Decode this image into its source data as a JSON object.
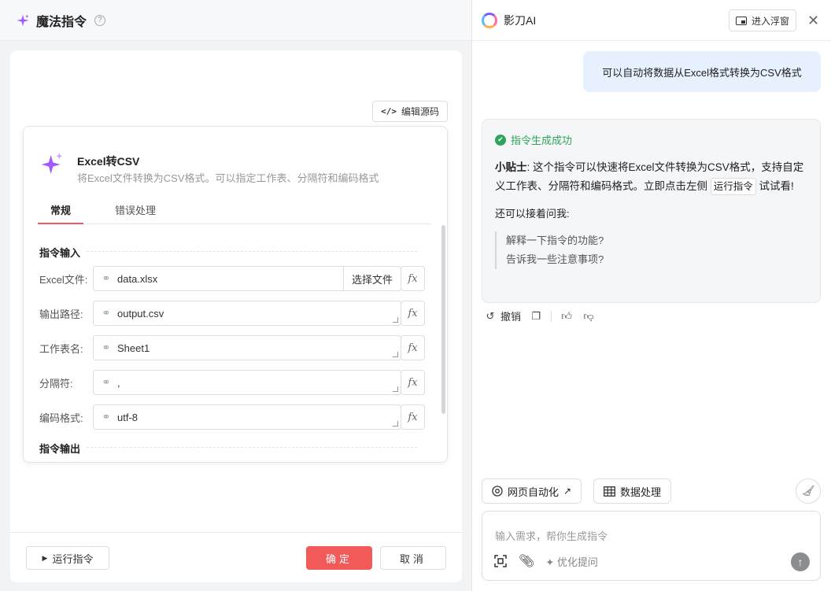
{
  "left": {
    "title": "魔法指令",
    "help": "?",
    "edit_source": "编辑源码",
    "card": {
      "name": "Excel转CSV",
      "description": "将Excel文件转换为CSV格式。可以指定工作表、分隔符和编码格式",
      "tabs": [
        "常规",
        "错误处理"
      ],
      "input_section": "指令输入",
      "output_section": "指令输出",
      "fields": [
        {
          "label": "Excel文件:",
          "value": "data.xlsx",
          "button": "选择文件"
        },
        {
          "label": "输出路径:",
          "value": "output.csv"
        },
        {
          "label": "工作表名:",
          "value": "Sheet1"
        },
        {
          "label": "分隔符:",
          "value": ","
        },
        {
          "label": "编码格式:",
          "value": "utf-8"
        }
      ],
      "fx": "fx"
    },
    "run": "运行指令",
    "ok": "确定",
    "cancel": "取消"
  },
  "right": {
    "app_name": "影刀AI",
    "float_btn": "进入浮窗",
    "user_message": "可以自动将数据从Excel格式转换为CSV格式",
    "success": "指令生成成功",
    "tip_label": "小贴士",
    "tip_part1": ": 这个指令可以快速将Excel文件转换为CSV格式，支持自定义工作表、分隔符和编码格式。立即点击左侧",
    "tip_button": "运行指令",
    "tip_part2": "试试看!",
    "ask_more": "还可以接着问我:",
    "suggestions": [
      "解释一下指令的功能?",
      "告诉我一些注意事项?"
    ],
    "undo": "撤销",
    "chips": [
      "网页自动化",
      "数据处理"
    ],
    "input_placeholder": "输入需求，帮你生成指令",
    "optimize": "优化提问"
  }
}
